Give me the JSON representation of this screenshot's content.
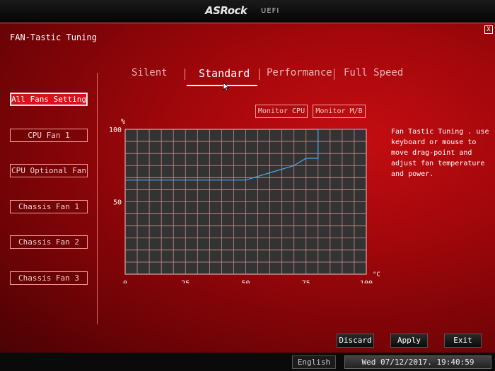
{
  "app": {
    "logo": "ASRock",
    "subtitle": "UEFI"
  },
  "page": {
    "title": "FAN-Tastic Tuning",
    "close_label": "X"
  },
  "fans": [
    {
      "label": "All Fans Setting",
      "active": true
    },
    {
      "label": "CPU Fan 1",
      "active": false
    },
    {
      "label": "CPU Optional Fan",
      "active": false
    },
    {
      "label": "Chassis Fan 1",
      "active": false
    },
    {
      "label": "Chassis Fan 2",
      "active": false
    },
    {
      "label": "Chassis Fan 3",
      "active": false
    }
  ],
  "modes": [
    {
      "label": "Silent",
      "active": false
    },
    {
      "label": "Standard",
      "active": true
    },
    {
      "label": "Performance",
      "active": false
    },
    {
      "label": "Full Speed",
      "active": false
    }
  ],
  "monitor": {
    "cpu_label": "Monitor CPU",
    "mb_label": "Monitor M/B"
  },
  "help_text": "Fan Tastic Tuning . use keyboard or mouse to move drag-point and adjust fan temperature and power.",
  "actions": {
    "discard": "Discard",
    "apply": "Apply",
    "exit": "Exit"
  },
  "status": {
    "language": "English",
    "datetime": "Wed 07/12/2017. 19:40:59"
  },
  "chart_data": {
    "type": "line",
    "x_unit": "°C",
    "y_unit": "%",
    "xlim": [
      0,
      100
    ],
    "ylim": [
      0,
      100
    ],
    "x_ticks": [
      "0",
      "25",
      "50",
      "75",
      "100"
    ],
    "y_ticks": [
      "50",
      "100"
    ],
    "grid": true,
    "series": [
      {
        "x": [
          0,
          50,
          60,
          70,
          75,
          80,
          80,
          100
        ],
        "y": [
          65,
          65,
          70,
          75,
          80,
          80,
          100,
          100
        ]
      }
    ]
  }
}
